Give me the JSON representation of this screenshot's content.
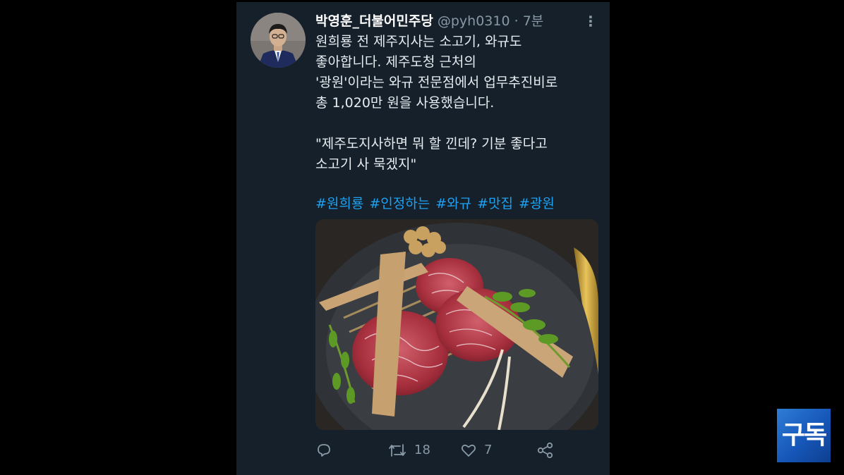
{
  "tweet": {
    "author_name": "박영훈_더불어민주당",
    "handle": "@pyh0310",
    "separator": "·",
    "time": "7분",
    "more_glyph": "⋮",
    "body_lines_1": [
      "원희룡 전 제주지사는 소고기, 와규도",
      "좋아합니다. 제주도청 근처의",
      "'광원'이라는 와규 전문점에서 업무추진비로",
      "총 1,020만 원을 사용했습니다."
    ],
    "body_lines_2": [
      "\"제주도지사하면 뭐 할 낀데? 기분 좋다고",
      "소고기 사 묵겠지\""
    ],
    "hashtags": [
      "#원희룡",
      "#인정하는",
      "#와규",
      "#맛집",
      "#광원"
    ],
    "retweet_count": "18",
    "like_count": "7"
  },
  "icons": {
    "reply": "reply-icon",
    "retweet": "retweet-icon",
    "like": "heart-icon",
    "share": "share-icon",
    "more": "more-vertical-icon"
  },
  "badge": {
    "label": "구독"
  },
  "colors": {
    "card_bg": "#15202b",
    "text": "#e6ecf0",
    "muted": "#8899a6",
    "hashtag": "#1da1f2",
    "badge": "#1f6fd0"
  }
}
